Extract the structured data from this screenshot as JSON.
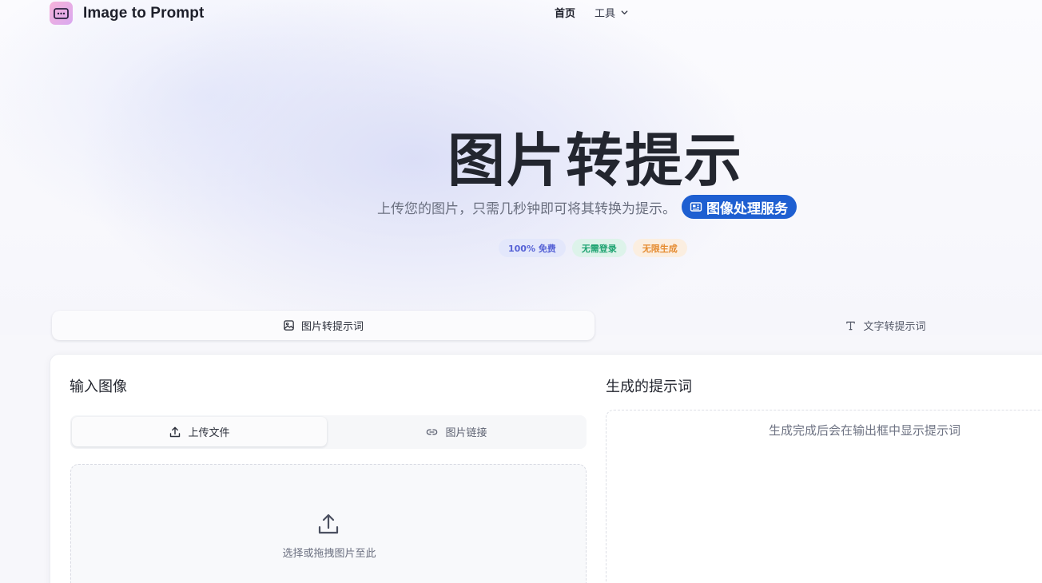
{
  "header": {
    "brand_name": "Image to Prompt",
    "nav_home": "首页",
    "nav_tools": "工具"
  },
  "hero": {
    "title": "图片转提示",
    "subtitle": "上传您的图片，只需几秒钟即可将其转换为提示。",
    "service_button": "图像处理服务",
    "badges": [
      "100% 免费",
      "无需登录",
      "无限生成"
    ]
  },
  "mode_tabs": {
    "image_to_prompt": "图片转提示词",
    "text_to_prompt": "文字转提示词"
  },
  "input": {
    "title": "输入图像",
    "tab_upload": "上传文件",
    "tab_link": "图片链接",
    "drop_text": "选择或拖拽图片至此"
  },
  "output": {
    "title": "生成的提示词",
    "placeholder": "生成完成后会在输出框中显示提示词"
  },
  "colors": {
    "accent": "#1e5fd1",
    "badge_blue": "#5662d6",
    "badge_green": "#1ea371",
    "badge_orange": "#e58a2e"
  },
  "icons": [
    "app-logo-icon",
    "chevron-down-icon",
    "newspaper-icon",
    "image-icon",
    "text-icon",
    "upload-icon",
    "link-icon"
  ]
}
